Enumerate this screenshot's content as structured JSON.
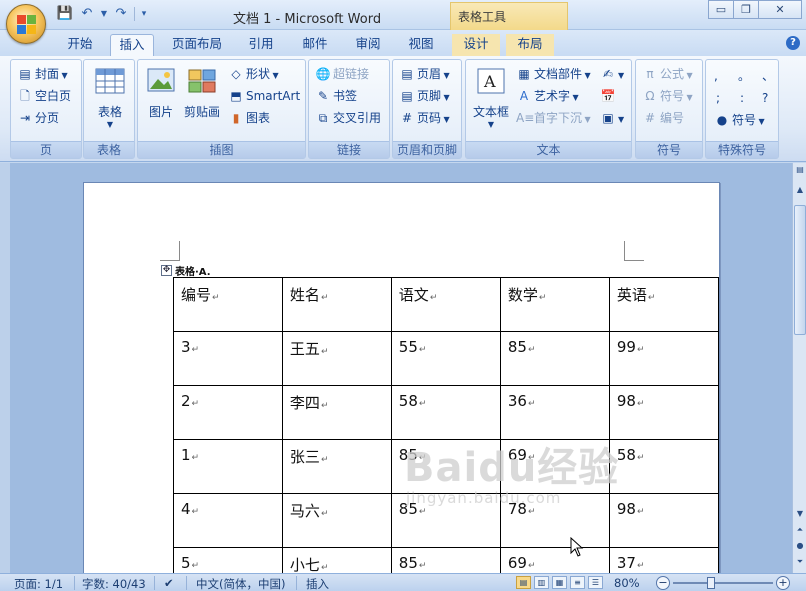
{
  "title": "文档 1 - Microsoft Word",
  "context_tab_title": "表格工具",
  "window_buttons": {
    "minimize": "▭",
    "restore": "❐",
    "close": "✕"
  },
  "tabs": [
    "开始",
    "插入",
    "页面布局",
    "引用",
    "邮件",
    "审阅",
    "视图",
    "设计",
    "布局"
  ],
  "ribbon": {
    "pages": {
      "label": "页",
      "items": [
        "封面",
        "空白页",
        "分页"
      ]
    },
    "tables": {
      "label": "表格",
      "button": "表格"
    },
    "illustrations": {
      "label": "插图",
      "picture": "图片",
      "clipart": "剪贴画",
      "shapes": "形状",
      "smartart": "SmartArt",
      "chart": "图表"
    },
    "links": {
      "label": "链接",
      "hyperlink": "超链接",
      "bookmark": "书签",
      "crossref": "交叉引用"
    },
    "headerfooter": {
      "label": "页眉和页脚",
      "header": "页眉",
      "footer": "页脚",
      "pagenum": "页码"
    },
    "text": {
      "label": "文本",
      "textbox": "文本框",
      "quickparts": "文档部件",
      "wordart": "艺术字",
      "dropcap": "首字下沉"
    },
    "symbols": {
      "label": "符号",
      "equation": "公式",
      "symbol": "符号",
      "number": "编号"
    },
    "special": {
      "label": "特殊符号",
      "chars": [
        ",",
        "。",
        "、",
        ";",
        ":",
        "?"
      ],
      "symbol": "符号"
    }
  },
  "document": {
    "caption": "表格·A.",
    "headers": [
      "编号",
      "姓名",
      "语文",
      "数学",
      "英语"
    ],
    "rows": [
      [
        "3",
        "王五",
        "55",
        "85",
        "99"
      ],
      [
        "2",
        "李四",
        "58",
        "36",
        "98"
      ],
      [
        "1",
        "张三",
        "85",
        "69",
        "58"
      ],
      [
        "4",
        "马六",
        "85",
        "78",
        "98"
      ],
      [
        "5",
        "小七",
        "85",
        "69",
        "37"
      ]
    ],
    "paragraph_mark": "↵",
    "watermark_brand": "Baidu经验",
    "watermark_site": "jingyan.baidu.com"
  },
  "status": {
    "page": "页面: 1/1",
    "words": "字数: 40/43",
    "language": "中文(简体，中国)",
    "mode": "插入",
    "zoom": "80%"
  }
}
